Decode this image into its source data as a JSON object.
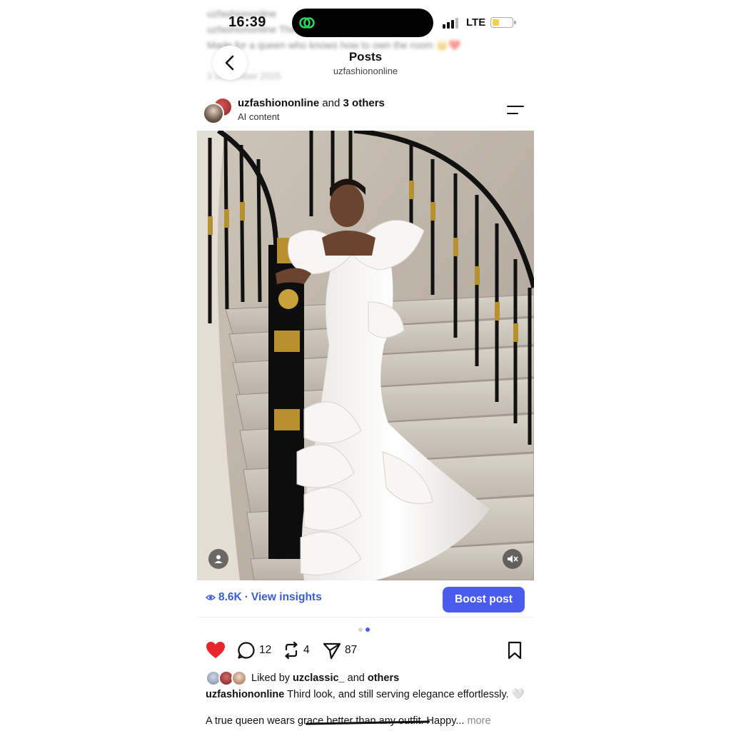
{
  "status_bar": {
    "time": "16:39",
    "network": "LTE",
    "battery_level": 0.35,
    "signal_bars": 3
  },
  "header": {
    "title": "Posts",
    "subtitle": "uzfashiononline"
  },
  "background_text": {
    "line1": "uzfashiononline",
    "line2": "uzfashiononline Third look, and still serving 😍",
    "line3": "Made for a queen who knows how to own the room 👑❤️",
    "date": "3 December 2025"
  },
  "post": {
    "author": "uzfashiononline",
    "and_text": "and",
    "others_text": "3 others",
    "label": "AI content",
    "image_alt": "Woman in white feathered mermaid gown on a curved staircase"
  },
  "insights": {
    "views": "8.6K",
    "separator": "·",
    "link": "View insights",
    "boost_label": "Boost post"
  },
  "carousel": {
    "count": 2,
    "active": 1
  },
  "actions": {
    "like_count": "",
    "comments": "12",
    "reposts": "4",
    "shares": "87"
  },
  "liked_by": {
    "prefix": "Liked by",
    "user": "uzclassic_",
    "and": "and",
    "others": "others"
  },
  "caption": {
    "author": "uzfashiononline",
    "text": "Third look, and still serving elegance effortlessly. 🤍",
    "line3": "A true queen wears grace better than any outfit. Happy...",
    "more": "more"
  },
  "colors": {
    "accent": "#4a5cf0",
    "link": "#3b5bd6",
    "like": "#e8262c"
  },
  "icons": {
    "back": "chevron-left-icon",
    "menu": "menu-icon",
    "like": "heart-icon",
    "comment": "comment-icon",
    "repost": "repost-icon",
    "share": "send-icon",
    "save": "bookmark-icon",
    "tag": "person-tag-icon",
    "mute": "muted-speaker-icon",
    "views": "eye-icon"
  }
}
